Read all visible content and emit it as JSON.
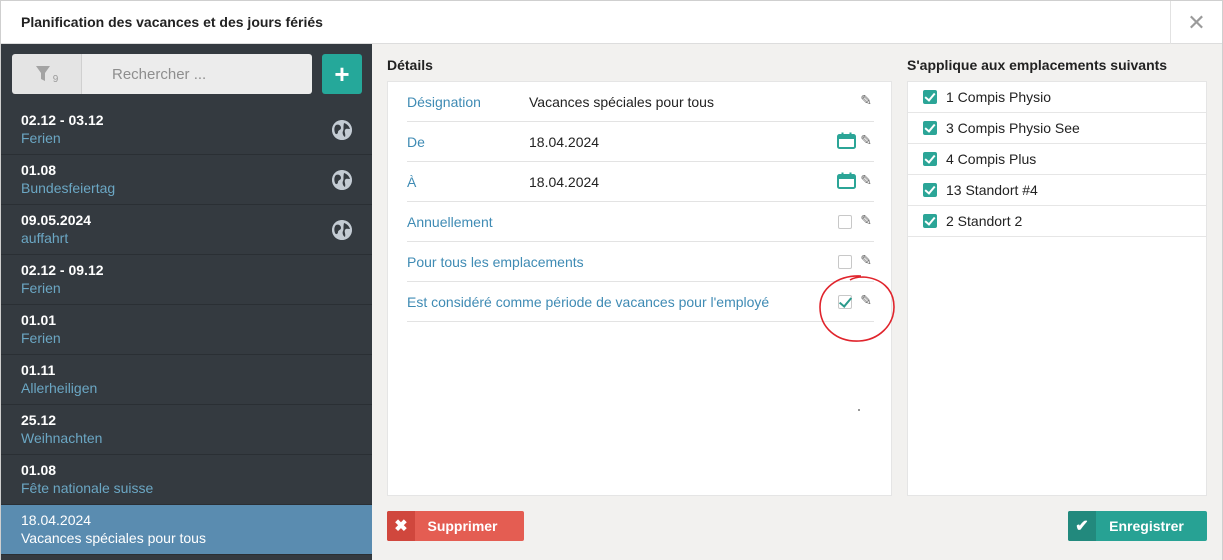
{
  "window": {
    "title": "Planification des vacances et des jours fériés",
    "close_symbol": "✕"
  },
  "search": {
    "filter_count": "9",
    "placeholder": "Rechercher ...",
    "add_symbol": "+"
  },
  "holidays": [
    {
      "date": "02.12 - 03.12",
      "name": "Ferien",
      "global": true
    },
    {
      "date": "01.08",
      "name": "Bundesfeiertag",
      "global": true
    },
    {
      "date": "09.05.2024",
      "name": "auffahrt",
      "global": true
    },
    {
      "date": "02.12 - 09.12",
      "name": "Ferien",
      "global": false
    },
    {
      "date": "01.01",
      "name": "Ferien",
      "global": false
    },
    {
      "date": "01.11",
      "name": "Allerheiligen",
      "global": false
    },
    {
      "date": "25.12",
      "name": "Weihnachten",
      "global": false
    },
    {
      "date": "01.08",
      "name": "Fête nationale suisse",
      "global": false
    },
    {
      "date": "18.04.2024",
      "name": "Vacances spéciales pour tous",
      "global": false,
      "selected": true
    }
  ],
  "details": {
    "section_title": "Détails",
    "designation_label": "Désignation",
    "designation_value": "Vacances spéciales pour tous",
    "from_label": "De",
    "from_value": "18.04.2024",
    "to_label": "À",
    "to_value": "18.04.2024",
    "annually_label": "Annuellement",
    "annually_checked": false,
    "all_locations_label": "Pour tous les emplacements",
    "all_locations_checked": false,
    "vacation_period_label": "Est considéré comme période de vacances pour l'employé",
    "vacation_period_checked": true
  },
  "locations": {
    "section_title": "S'applique aux emplacements suivants",
    "items": [
      {
        "label": "1 Compis Physio",
        "checked": true
      },
      {
        "label": "3 Compis Physio See",
        "checked": true
      },
      {
        "label": "4 Compis Plus",
        "checked": true
      },
      {
        "label": "13 Standort #4",
        "checked": true
      },
      {
        "label": "2 Standort 2",
        "checked": true
      }
    ]
  },
  "actions": {
    "delete_label": "Supprimer",
    "save_label": "Enregistrer"
  },
  "colors": {
    "accent_teal": "#27a294",
    "delete_red": "#e45d52",
    "sidebar_bg": "#343a40",
    "selected_bg": "#5a8cb0",
    "label_blue": "#3f8bb4",
    "annotation_red": "#e0242c"
  }
}
